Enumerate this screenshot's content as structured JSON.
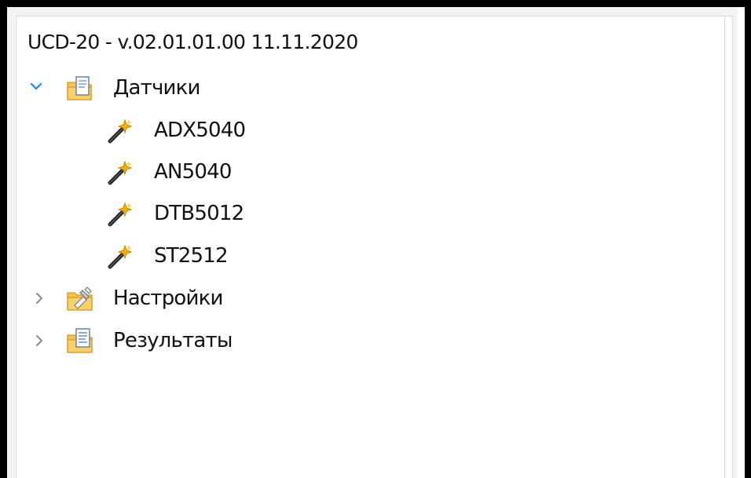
{
  "tree": {
    "root": {
      "label": "UCD-20 - v.02.01.01.00 11.11.2020"
    },
    "items": [
      {
        "label": "Датчики",
        "expanded": true,
        "icon": "folder-document-icon",
        "children": [
          {
            "label": "ADX5040",
            "icon": "magic-wand-icon"
          },
          {
            "label": "AN5040",
            "icon": "magic-wand-icon"
          },
          {
            "label": "DTB5012",
            "icon": "magic-wand-icon"
          },
          {
            "label": "ST2512",
            "icon": "magic-wand-icon"
          }
        ]
      },
      {
        "label": "Настройки",
        "expanded": false,
        "icon": "folder-settings-icon"
      },
      {
        "label": "Результаты",
        "expanded": false,
        "icon": "folder-results-icon"
      }
    ]
  },
  "colors": {
    "outer_border": "#000000",
    "inner_border": "#f3f3f3",
    "panel_background": "#ffffff",
    "expanded_chevron": "#2d8ee8",
    "collapsed_chevron": "#8a8a8a",
    "folder": "#f2c45a",
    "folder_dark": "#d69b22",
    "wand": "#202020",
    "spark": "#f0b400"
  }
}
